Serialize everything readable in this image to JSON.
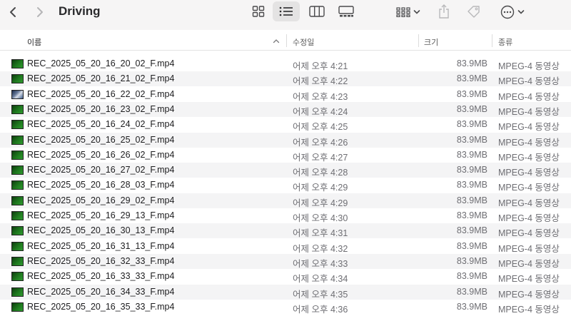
{
  "toolbar": {
    "title": "Driving",
    "back_icon": "chevron-left-icon",
    "forward_icon": "chevron-right-icon",
    "views": [
      "icon-view",
      "list-view",
      "column-view",
      "gallery-view"
    ],
    "active_view": "list-view"
  },
  "columns": {
    "name": "이름",
    "date": "수정일",
    "size": "크기",
    "kind": "종류"
  },
  "files": [
    {
      "name": "REC_2025_05_20_16_20_02_F.mp4",
      "date": "어제 오후 4:21",
      "size": "83.9MB",
      "kind": "MPEG-4 동영상"
    },
    {
      "name": "REC_2025_05_20_16_21_02_F.mp4",
      "date": "어제 오후 4:22",
      "size": "83.9MB",
      "kind": "MPEG-4 동영상"
    },
    {
      "name": "REC_2025_05_20_16_22_02_F.mp4",
      "date": "어제 오후 4:23",
      "size": "83.9MB",
      "kind": "MPEG-4 동영상"
    },
    {
      "name": "REC_2025_05_20_16_23_02_F.mp4",
      "date": "어제 오후 4:24",
      "size": "83.9MB",
      "kind": "MPEG-4 동영상"
    },
    {
      "name": "REC_2025_05_20_16_24_02_F.mp4",
      "date": "어제 오후 4:25",
      "size": "83.9MB",
      "kind": "MPEG-4 동영상"
    },
    {
      "name": "REC_2025_05_20_16_25_02_F.mp4",
      "date": "어제 오후 4:26",
      "size": "83.9MB",
      "kind": "MPEG-4 동영상"
    },
    {
      "name": "REC_2025_05_20_16_26_02_F.mp4",
      "date": "어제 오후 4:27",
      "size": "83.9MB",
      "kind": "MPEG-4 동영상"
    },
    {
      "name": "REC_2025_05_20_16_27_02_F.mp4",
      "date": "어제 오후 4:28",
      "size": "83.9MB",
      "kind": "MPEG-4 동영상"
    },
    {
      "name": "REC_2025_05_20_16_28_03_F.mp4",
      "date": "어제 오후 4:29",
      "size": "83.9MB",
      "kind": "MPEG-4 동영상"
    },
    {
      "name": "REC_2025_05_20_16_29_02_F.mp4",
      "date": "어제 오후 4:29",
      "size": "83.9MB",
      "kind": "MPEG-4 동영상"
    },
    {
      "name": "REC_2025_05_20_16_29_13_F.mp4",
      "date": "어제 오후 4:30",
      "size": "83.9MB",
      "kind": "MPEG-4 동영상"
    },
    {
      "name": "REC_2025_05_20_16_30_13_F.mp4",
      "date": "어제 오후 4:31",
      "size": "83.9MB",
      "kind": "MPEG-4 동영상"
    },
    {
      "name": "REC_2025_05_20_16_31_13_F.mp4",
      "date": "어제 오후 4:32",
      "size": "83.9MB",
      "kind": "MPEG-4 동영상"
    },
    {
      "name": "REC_2025_05_20_16_32_33_F.mp4",
      "date": "어제 오후 4:33",
      "size": "83.9MB",
      "kind": "MPEG-4 동영상"
    },
    {
      "name": "REC_2025_05_20_16_33_33_F.mp4",
      "date": "어제 오후 4:34",
      "size": "83.9MB",
      "kind": "MPEG-4 동영상"
    },
    {
      "name": "REC_2025_05_20_16_34_33_F.mp4",
      "date": "어제 오후 4:35",
      "size": "83.9MB",
      "kind": "MPEG-4 동영상"
    },
    {
      "name": "REC_2025_05_20_16_35_33_F.mp4",
      "date": "어제 오후 4:36",
      "size": "83.9MB",
      "kind": "MPEG-4 동영상"
    }
  ]
}
